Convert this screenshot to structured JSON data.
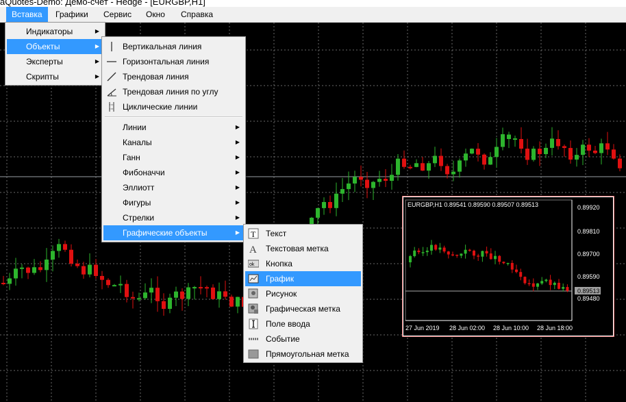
{
  "window": {
    "title": "aQuotes-Demo: Демо-счет - Hedge - [EURGBP,H1]"
  },
  "menubar": {
    "items": [
      "Вставка",
      "Графики",
      "Сервис",
      "Окно",
      "Справка"
    ]
  },
  "insert_menu": {
    "items": [
      "Индикаторы",
      "Объекты",
      "Эксперты",
      "Скрипты"
    ]
  },
  "objects_menu": {
    "lines": [
      {
        "label": "Вертикальная линия",
        "icon": "vertical-line-icon"
      },
      {
        "label": "Горизонтальная линия",
        "icon": "horizontal-line-icon"
      },
      {
        "label": "Трендовая линия",
        "icon": "trend-line-icon"
      },
      {
        "label": "Трендовая линия по углу",
        "icon": "trend-angle-icon"
      },
      {
        "label": "Циклические линии",
        "icon": "cycle-lines-icon"
      }
    ],
    "groups": [
      "Линии",
      "Каналы",
      "Ганн",
      "Фибоначчи",
      "Эллиотт",
      "Фигуры",
      "Стрелки",
      "Графические объекты"
    ]
  },
  "graphic_objects_menu": {
    "items": [
      {
        "label": "Текст",
        "icon": "text-icon"
      },
      {
        "label": "Текстовая метка",
        "icon": "text-label-icon"
      },
      {
        "label": "Кнопка",
        "icon": "button-icon"
      },
      {
        "label": "График",
        "icon": "chart-icon"
      },
      {
        "label": "Рисунок",
        "icon": "picture-icon"
      },
      {
        "label": "Графическая метка",
        "icon": "bitmap-label-icon"
      },
      {
        "label": "Поле ввода",
        "icon": "edit-field-icon"
      },
      {
        "label": "Событие",
        "icon": "event-icon"
      },
      {
        "label": "Прямоугольная метка",
        "icon": "rect-label-icon"
      }
    ]
  },
  "mini_chart": {
    "header": "EURGBP,H1  0.89541 0.89590 0.89507 0.89513",
    "price_labels": [
      "0.89920",
      "0.89810",
      "0.89700",
      "0.89590",
      "0.89480"
    ],
    "current_price": "0.89513",
    "time_labels": [
      "27 Jun 2019",
      "28 Jun 02:00",
      "28 Jun 10:00",
      "28 Jun 18:00"
    ]
  },
  "colors": {
    "bull": "#2db52d",
    "bear": "#e01010",
    "highlight": "#3399ff",
    "grid": "#6a6a6a"
  }
}
